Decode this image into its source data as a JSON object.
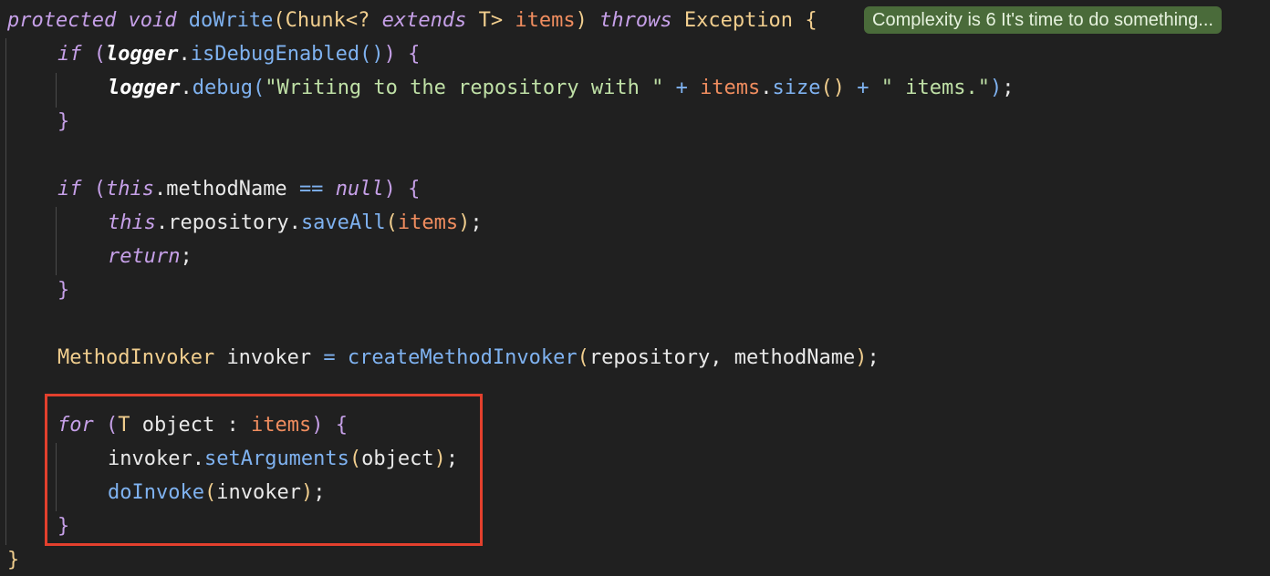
{
  "editor": {
    "hint": "Complexity is 6 It's time to do something...",
    "tokens": {
      "l1": [
        "protected",
        "void",
        "doWrite",
        "(",
        "Chunk",
        "<?",
        "extends",
        "T>",
        "items",
        ")",
        "throws",
        "Exception",
        "{"
      ],
      "l2": [
        "if",
        "(",
        "logger",
        ".",
        "isDebugEnabled",
        "(",
        ")",
        ")",
        "{"
      ],
      "l3": [
        "logger",
        ".",
        "debug",
        "(",
        "\"Writing to the repository with \"",
        "+",
        "items",
        ".",
        "size",
        "(",
        ")",
        "+",
        "\" items.\"",
        ")",
        ";"
      ],
      "l4": [
        "}"
      ],
      "l6": [
        "if",
        "(",
        "this",
        ".methodName",
        "==",
        "null",
        ")",
        "{"
      ],
      "l7": [
        "this",
        ".repository.",
        "saveAll",
        "(",
        "items",
        ")",
        ";"
      ],
      "l8": [
        "return",
        ";"
      ],
      "l9": [
        "}"
      ],
      "l11": [
        "MethodInvoker",
        "invoker",
        "=",
        "createMethodInvoker",
        "(",
        "repository, methodName",
        ")",
        ";"
      ],
      "l13": [
        "for",
        "(",
        "T",
        "object",
        ":",
        "items",
        ")",
        "{"
      ],
      "l14": [
        "invoker.",
        "setArguments",
        "(",
        "object",
        ")",
        ";"
      ],
      "l15": [
        "doInvoke",
        "(",
        "invoker",
        ")",
        ";"
      ],
      "l16": [
        "}"
      ],
      "l17": [
        "}"
      ]
    }
  },
  "colors": {
    "background": "#202020",
    "keyword": "#c6a0e8",
    "function": "#7fb2f0",
    "type": "#f1ce8e",
    "parameter": "#f08d5f",
    "string": "#bfe0a6",
    "hint_background": "#4a6b3a",
    "highlight_border": "#e3402d"
  }
}
